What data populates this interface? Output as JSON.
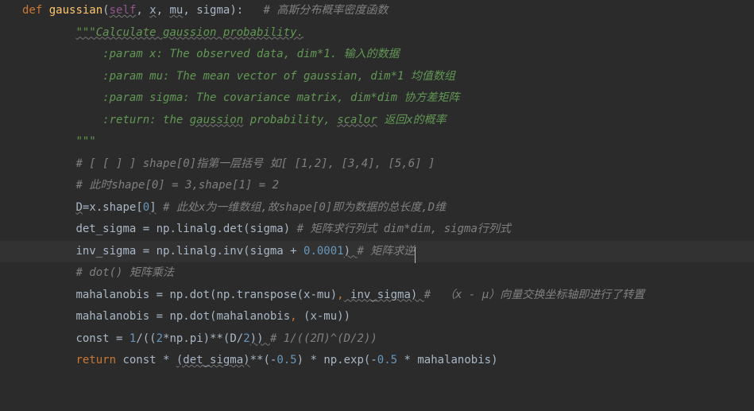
{
  "line1": {
    "kw": "def",
    "fn": "gaussian",
    "lp": "(",
    "self": "self",
    "c1": ", ",
    "p1": "x",
    "c2": ", ",
    "p2": "mu",
    "c3": ", ",
    "p3": "sigma",
    "rp": "):",
    "sp": "   ",
    "cmt": "# 高斯分布概率密度函数"
  },
  "line2": {
    "indent": "        ",
    "doc": "\"\"\"Calculate gaussion probability."
  },
  "line3": {
    "indent": "",
    "blank": ""
  },
  "line4": {
    "indent": "            ",
    "doc": ":param x: The observed data, dim*1. 输入的数据"
  },
  "line5": {
    "indent": "            ",
    "doc": ":param mu: The mean vector of gaussian, dim*1 均值数组"
  },
  "line6": {
    "indent": "            ",
    "doc": ":param sigma: The covariance matrix, dim*dim 协方差矩阵"
  },
  "line7": {
    "indent": "            ",
    "d1": ":return: the ",
    "d2": "gaussion",
    "d3": " probability, ",
    "d4": "scalor",
    "d5": " 返回x的概率"
  },
  "line8": {
    "indent": "        ",
    "doc": "\"\"\""
  },
  "line9": {
    "indent": "        ",
    "cmt": "# [ [ ] ] shape[0]指第一层括号 如[ [1,2], [3,4], [5,6] ]"
  },
  "line10": {
    "indent": "        ",
    "cmt": "# 此时shape[0] = 3,shape[1] = 2"
  },
  "line11": {
    "indent": "        ",
    "a": "D",
    "eq": "=",
    "b": "x.shape[",
    "n": "0",
    "c": "]",
    "sp": " ",
    "cmt": "# 此处x为一维数组,故shape[0]即为数据的总长度,D维"
  },
  "line12": {
    "indent": "        ",
    "a": "det_sigma = np.linalg.det(sigma) ",
    "cmt": "# 矩阵求行列式 dim*dim, sigma行列式"
  },
  "line13": {
    "indent": "        ",
    "a": "inv_sigma = np.linalg.inv(sigma + ",
    "n": "0.0001",
    "b": ") ",
    "cmt": "# 矩阵求逆"
  },
  "line14": {
    "indent": "        ",
    "cmt": "# dot() 矩阵乘法"
  },
  "line15": {
    "indent": "        ",
    "a": "mahalanobis = np.dot(np.transpose(x-mu)",
    "comma": ",",
    "b": " inv_sigma) ",
    "cmt": "#  （x - μ）向量交换坐标轴即进行了转置"
  },
  "line16": {
    "indent": "        ",
    "a": "mahalanobis = np.dot(mahalanobis",
    "comma": ",",
    "b": " (x-mu))"
  },
  "line17": {
    "indent": "        ",
    "a": "const = ",
    "n1": "1",
    "b": "/((",
    "n2": "2",
    "c": "*np.pi)**(D/",
    "n3": "2",
    "d": ")) ",
    "cmt": "# 1/((2Π)^(D/2))"
  },
  "line18": {
    "indent": "        ",
    "ret": "return",
    "a": " const * ",
    "ds": "(det_sigma)",
    "b": "**(-",
    "n1": "0.5",
    "c": ") * np.exp(-",
    "n2": "0.5",
    "d": " * mahalanobis)"
  }
}
